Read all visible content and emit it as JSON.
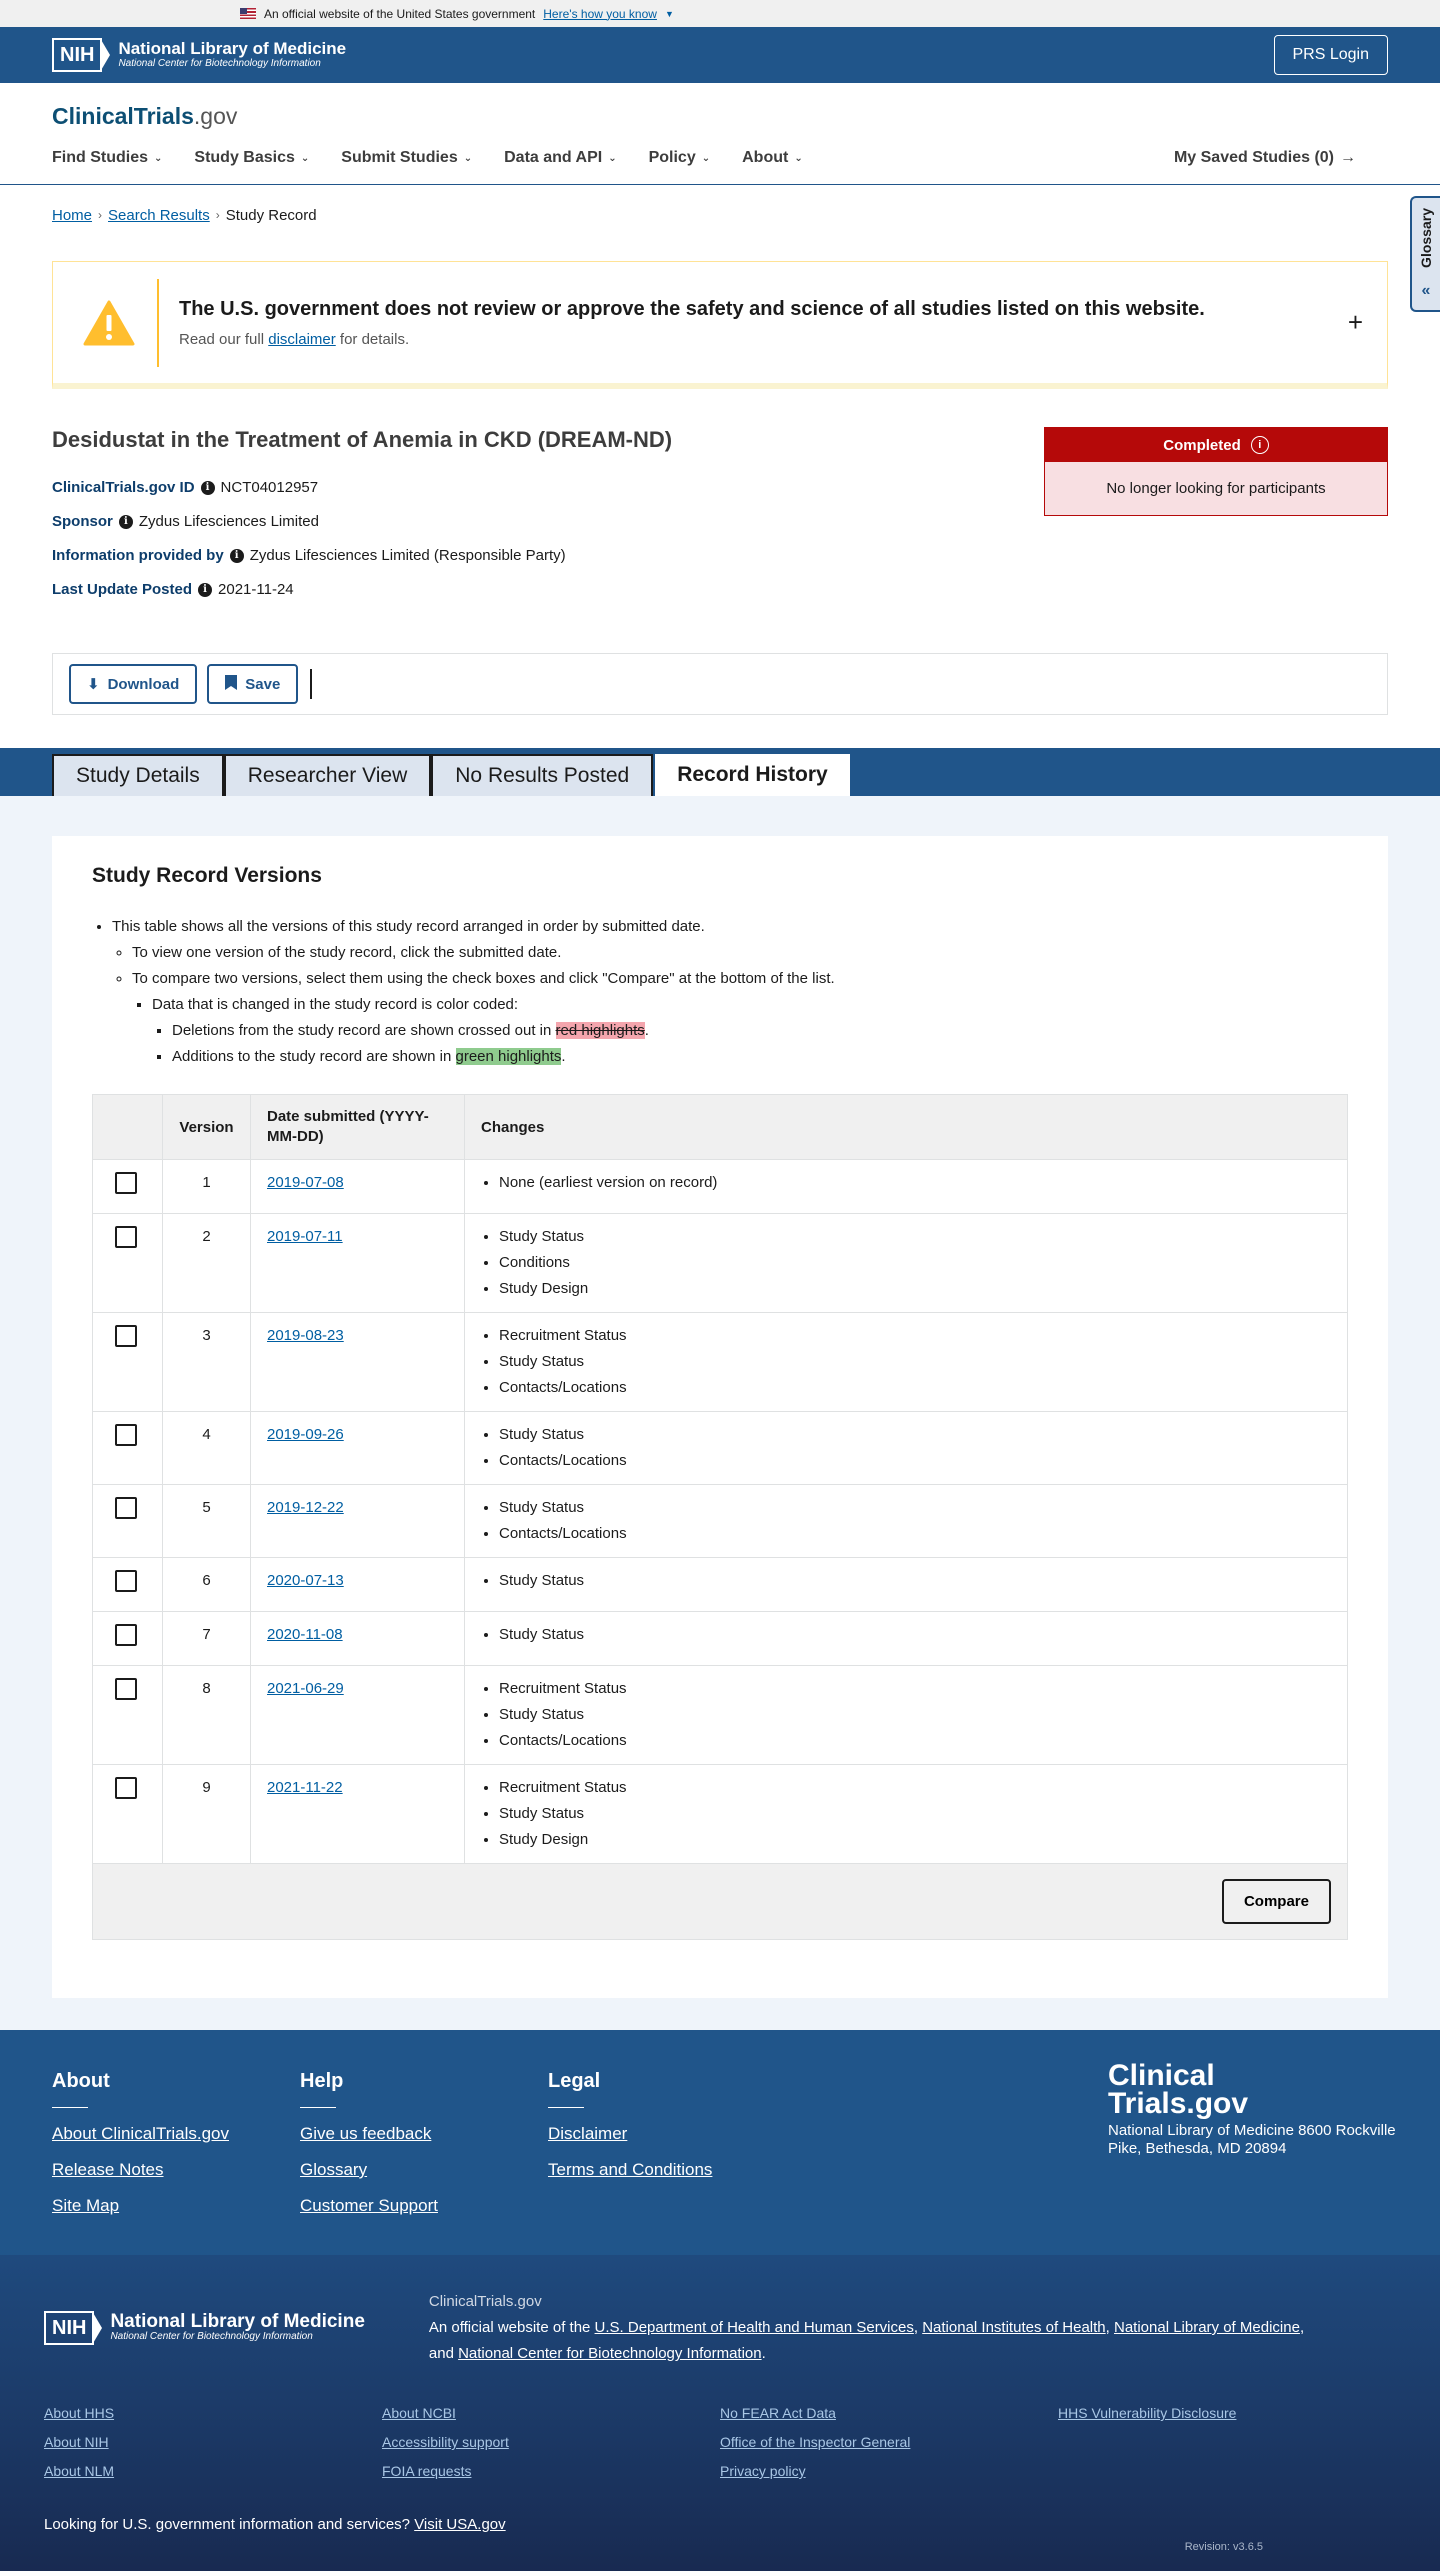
{
  "gov_banner": {
    "text": "An official website of the United States government",
    "link": "Here's how you know"
  },
  "nih_header": {
    "logo_abbr": "NIH",
    "logo_title": "National Library of Medicine",
    "logo_subtitle": "National Center for Biotechnology Information",
    "prs_login": "PRS Login"
  },
  "site": {
    "logo_main": "ClinicalTrials",
    "logo_suffix": ".gov"
  },
  "nav": {
    "items": [
      "Find Studies",
      "Study Basics",
      "Submit Studies",
      "Data and API",
      "Policy",
      "About"
    ],
    "saved": "My Saved Studies (0)"
  },
  "breadcrumb": {
    "home": "Home",
    "results": "Search Results",
    "current": "Study Record"
  },
  "glossary": "Glossary",
  "disclaimer": {
    "title": "The U.S. government does not review or approve the safety and science of all studies listed on this website.",
    "pre": "Read our full",
    "link": "disclaimer",
    "post": "for details."
  },
  "study": {
    "title": "Desidustat in the Treatment of Anemia in CKD (DREAM-ND)",
    "id_label": "ClinicalTrials.gov ID",
    "id_value": "NCT04012957",
    "sponsor_label": "Sponsor",
    "sponsor_value": "Zydus Lifesciences Limited",
    "provided_label": "Information provided by",
    "provided_value": "Zydus Lifesciences Limited (Responsible Party)",
    "update_label": "Last Update Posted",
    "update_value": "2021-11-24",
    "status": "Completed",
    "status_sub": "No longer looking for participants",
    "status_color": "#b50909"
  },
  "actions": {
    "download": "Download",
    "save": "Save"
  },
  "tabs": [
    "Study Details",
    "Researcher View",
    "No Results Posted",
    "Record History"
  ],
  "versions": {
    "heading": "Study Record Versions",
    "b1": "This table shows all the versions of this study record arranged in order by submitted date.",
    "b2": "To view one version of the study record, click the submitted date.",
    "b3": "To compare two versions, select them using the check boxes and click \"Compare\" at the bottom of the list.",
    "b4": "Data that is changed in the study record is color coded:",
    "b5_pre": "Deletions from the study record are shown crossed out in",
    "b5_hl": "red highlights",
    "b6_pre": "Additions to the study record are shown in",
    "b6_hl": "green highlights",
    "col_version": "Version",
    "col_date": "Date submitted (YYYY-MM-DD)",
    "col_changes": "Changes",
    "compare": "Compare",
    "rows": [
      {
        "version": "1",
        "date": "2019-07-08",
        "changes": [
          "None (earliest version on record)"
        ]
      },
      {
        "version": "2",
        "date": "2019-07-11",
        "changes": [
          "Study Status",
          "Conditions",
          "Study Design"
        ]
      },
      {
        "version": "3",
        "date": "2019-08-23",
        "changes": [
          "Recruitment Status",
          "Study Status",
          "Contacts/Locations"
        ]
      },
      {
        "version": "4",
        "date": "2019-09-26",
        "changes": [
          "Study Status",
          "Contacts/Locations"
        ]
      },
      {
        "version": "5",
        "date": "2019-12-22",
        "changes": [
          "Study Status",
          "Contacts/Locations"
        ]
      },
      {
        "version": "6",
        "date": "2020-07-13",
        "changes": [
          "Study Status"
        ]
      },
      {
        "version": "7",
        "date": "2020-11-08",
        "changes": [
          "Study Status"
        ]
      },
      {
        "version": "8",
        "date": "2021-06-29",
        "changes": [
          "Recruitment Status",
          "Study Status",
          "Contacts/Locations"
        ]
      },
      {
        "version": "9",
        "date": "2021-11-22",
        "changes": [
          "Recruitment Status",
          "Study Status",
          "Study Design"
        ]
      }
    ]
  },
  "footer": {
    "about": {
      "title": "About",
      "links": [
        "About ClinicalTrials.gov",
        "Release Notes",
        "Site Map"
      ]
    },
    "help": {
      "title": "Help",
      "links": [
        "Give us feedback",
        "Glossary",
        "Customer Support"
      ]
    },
    "legal": {
      "title": "Legal",
      "links": [
        "Disclaimer",
        "Terms and Conditions"
      ]
    },
    "logo_line1": "Clinical",
    "logo_line2": "Trials.gov",
    "address": "National Library of Medicine 8600 Rockville Pike, Bethesda, MD 20894"
  },
  "footer2": {
    "site": "ClinicalTrials.gov",
    "official_pre": "An official website of the",
    "hhs": "U.S. Department of Health and Human Services",
    "nih": "National Institutes of Health",
    "nlm": "National Library of Medicine",
    "and": "and",
    "ncbi": "National Center for Biotechnology Information",
    "links_col1": [
      "About HHS",
      "About NIH",
      "About NLM"
    ],
    "links_col2": [
      "About NCBI",
      "Accessibility support",
      "FOIA requests"
    ],
    "links_col3": [
      "No FEAR Act Data",
      "Office of the Inspector General",
      "Privacy policy"
    ],
    "links_col4": [
      "HHS Vulnerability Disclosure"
    ],
    "usa_pre": "Looking for U.S. government information and services?",
    "usa_link": "Visit USA.gov",
    "revision": "Revision: v3.6.5"
  }
}
